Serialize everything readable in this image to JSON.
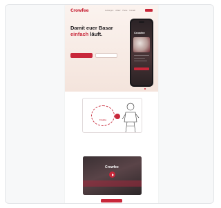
{
  "brand": {
    "name": "Crowfee",
    "accent_color": "#c8273a"
  },
  "nav": {
    "links": [
      "Leistungen",
      "Ablauf",
      "Preise",
      "Kontakt"
    ],
    "cta": ""
  },
  "hero": {
    "eyebrow": "",
    "headline_line1": "Damit euer Basar",
    "headline_accent": "einfach",
    "headline_end": " läuft.",
    "lead": "",
    "primary_button": "",
    "secondary_button": "",
    "checks": [
      "",
      "",
      ""
    ],
    "stats": [
      {
        "value": "",
        "label": ""
      },
      {
        "value": "",
        "label": ""
      },
      {
        "value": "",
        "label": ""
      }
    ]
  },
  "phone": {
    "app_name": "Crowfee"
  },
  "illustration": {
    "bubble_text": "",
    "bubble_brand": "Crowfee",
    "badge": ""
  },
  "section": {
    "title": "",
    "subtitle": ""
  },
  "video": {
    "logo": "Crowfee",
    "caption": ""
  },
  "bottom_cta": ""
}
